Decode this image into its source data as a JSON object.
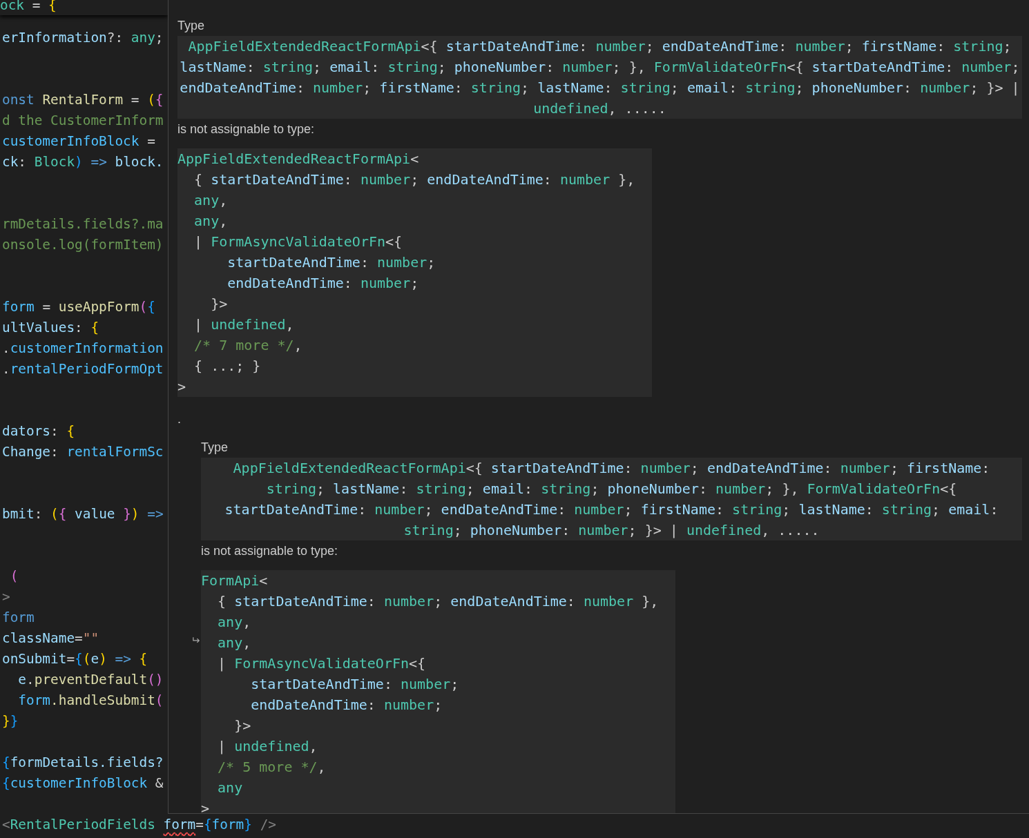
{
  "editor": {
    "sticky_line": {
      "tokens": [
        {
          "kind": "type",
          "text": "ock"
        },
        {
          "kind": "punct",
          "text": " = "
        },
        {
          "kind": "bracket1",
          "text": "{"
        }
      ]
    },
    "lines": [
      {
        "kind": "code",
        "tokens": [
          {
            "kind": "variable",
            "text": "erInformation"
          },
          {
            "kind": "punct",
            "text": "?: "
          },
          {
            "kind": "type",
            "text": "any"
          },
          {
            "kind": "punct",
            "text": ";"
          }
        ]
      },
      {
        "kind": "blank"
      },
      {
        "kind": "blank"
      },
      {
        "kind": "code",
        "tokens": [
          {
            "kind": "keyword",
            "text": "onst "
          },
          {
            "kind": "function",
            "text": "RentalForm"
          },
          {
            "kind": "punct",
            "text": " = "
          },
          {
            "kind": "bracket1",
            "text": "("
          },
          {
            "kind": "bracket2",
            "text": "{"
          }
        ]
      },
      {
        "kind": "code",
        "tokens": [
          {
            "kind": "comment",
            "text": "d the CustomerInform"
          }
        ]
      },
      {
        "kind": "code",
        "tokens": [
          {
            "kind": "constant",
            "text": "customerInfoBlock"
          },
          {
            "kind": "punct",
            "text": " ="
          }
        ]
      },
      {
        "kind": "code",
        "tokens": [
          {
            "kind": "variable",
            "text": "ck"
          },
          {
            "kind": "punct",
            "text": ": "
          },
          {
            "kind": "type",
            "text": "Block"
          },
          {
            "kind": "bracket3",
            "text": ") "
          },
          {
            "kind": "keyword",
            "text": "=> "
          },
          {
            "kind": "variable",
            "text": "block."
          }
        ]
      },
      {
        "kind": "blank"
      },
      {
        "kind": "blank"
      },
      {
        "kind": "code",
        "tokens": [
          {
            "kind": "comment",
            "text": "rmDetails.fields?.ma"
          }
        ]
      },
      {
        "kind": "code",
        "tokens": [
          {
            "kind": "comment",
            "text": "onsole.log(formItem)"
          }
        ]
      },
      {
        "kind": "blank"
      },
      {
        "kind": "blank"
      },
      {
        "kind": "code",
        "tokens": [
          {
            "kind": "constant",
            "text": "form"
          },
          {
            "kind": "punct",
            "text": " = "
          },
          {
            "kind": "function",
            "text": "useAppForm"
          },
          {
            "kind": "bracket2",
            "text": "("
          },
          {
            "kind": "bracket3",
            "text": "{"
          }
        ]
      },
      {
        "kind": "code",
        "tokens": [
          {
            "kind": "variable",
            "text": "ultValues"
          },
          {
            "kind": "punct",
            "text": ": "
          },
          {
            "kind": "bracket1",
            "text": "{"
          }
        ]
      },
      {
        "kind": "code",
        "tokens": [
          {
            "kind": "punct",
            "text": "."
          },
          {
            "kind": "constant",
            "text": "customerInformation"
          }
        ]
      },
      {
        "kind": "code",
        "tokens": [
          {
            "kind": "punct",
            "text": "."
          },
          {
            "kind": "constant",
            "text": "rentalPeriodFormOpt"
          }
        ]
      },
      {
        "kind": "blank"
      },
      {
        "kind": "blank"
      },
      {
        "kind": "code",
        "tokens": [
          {
            "kind": "variable",
            "text": "dators"
          },
          {
            "kind": "punct",
            "text": ": "
          },
          {
            "kind": "bracket1",
            "text": "{"
          }
        ]
      },
      {
        "kind": "code",
        "tokens": [
          {
            "kind": "variable",
            "text": "Change"
          },
          {
            "kind": "punct",
            "text": ": "
          },
          {
            "kind": "constant",
            "text": "rentalFormSc"
          }
        ]
      },
      {
        "kind": "blank"
      },
      {
        "kind": "blank"
      },
      {
        "kind": "code",
        "tokens": [
          {
            "kind": "variable",
            "text": "bmit"
          },
          {
            "kind": "punct",
            "text": ": "
          },
          {
            "kind": "bracket1",
            "text": "("
          },
          {
            "kind": "bracket2",
            "text": "{ "
          },
          {
            "kind": "variable",
            "text": "value "
          },
          {
            "kind": "bracket2",
            "text": "}"
          },
          {
            "kind": "bracket1",
            "text": ") "
          },
          {
            "kind": "keyword",
            "text": "=>"
          }
        ]
      },
      {
        "kind": "blank"
      },
      {
        "kind": "blank"
      },
      {
        "kind": "code",
        "tokens": [
          {
            "kind": "bracket2",
            "text": " ("
          }
        ]
      },
      {
        "kind": "code",
        "tokens": [
          {
            "kind": "tag",
            "text": ">"
          }
        ]
      },
      {
        "kind": "code",
        "tokens": [
          {
            "kind": "keyword",
            "text": "form"
          }
        ]
      },
      {
        "kind": "code",
        "tokens": [
          {
            "kind": "variable",
            "text": "className"
          },
          {
            "kind": "punct",
            "text": "="
          },
          {
            "kind": "string",
            "text": "\"\""
          }
        ]
      },
      {
        "kind": "code",
        "tokens": [
          {
            "kind": "variable",
            "text": "onSubmit"
          },
          {
            "kind": "punct",
            "text": "="
          },
          {
            "kind": "bracket3",
            "text": "{"
          },
          {
            "kind": "bracket1",
            "text": "("
          },
          {
            "kind": "variable",
            "text": "e"
          },
          {
            "kind": "bracket1",
            "text": ") "
          },
          {
            "kind": "keyword",
            "text": "=> "
          },
          {
            "kind": "bracket1",
            "text": "{"
          }
        ]
      },
      {
        "kind": "code",
        "tokens": [
          {
            "kind": "variable",
            "text": "  e"
          },
          {
            "kind": "punct",
            "text": "."
          },
          {
            "kind": "function",
            "text": "preventDefault"
          },
          {
            "kind": "bracket2",
            "text": "()"
          }
        ]
      },
      {
        "kind": "code",
        "tokens": [
          {
            "kind": "constant",
            "text": "  form"
          },
          {
            "kind": "function",
            "text": ".handleSubmit"
          },
          {
            "kind": "bracket2",
            "text": "("
          }
        ]
      },
      {
        "kind": "code",
        "tokens": [
          {
            "kind": "bracket1",
            "text": "}"
          },
          {
            "kind": "bracket3",
            "text": "}"
          }
        ]
      },
      {
        "kind": "blank"
      },
      {
        "kind": "code",
        "tokens": [
          {
            "kind": "bracket3",
            "text": "{"
          },
          {
            "kind": "variable",
            "text": "formDetails.fields?"
          }
        ]
      },
      {
        "kind": "code",
        "tokens": [
          {
            "kind": "bracket3",
            "text": "{"
          },
          {
            "kind": "constant",
            "text": "customerInfoBlock"
          },
          {
            "kind": "punct",
            "text": " &"
          }
        ]
      },
      {
        "kind": "blank"
      },
      {
        "kind": "code",
        "tokens": [
          {
            "kind": "tag",
            "text": "<"
          },
          {
            "kind": "type",
            "text": "RentalPeriodFields "
          },
          {
            "kind": "variable",
            "text": "form",
            "error": true
          },
          {
            "kind": "punct",
            "text": "="
          },
          {
            "kind": "bracket3",
            "text": "{"
          },
          {
            "kind": "constant",
            "text": "form"
          },
          {
            "kind": "bracket3",
            "text": "} "
          },
          {
            "kind": "tag",
            "text": "/>"
          }
        ]
      }
    ]
  },
  "hover": {
    "label": "Type",
    "source_type": [
      {
        "kind": "type",
        "text": "AppFieldExtendedReactFormApi"
      },
      {
        "kind": "punct",
        "text": "<{ "
      },
      {
        "kind": "prop",
        "text": "startDateAndTime"
      },
      {
        "kind": "punct",
        "text": ": "
      },
      {
        "kind": "type",
        "text": "number"
      },
      {
        "kind": "punct",
        "text": "; "
      },
      {
        "kind": "prop",
        "text": "endDateAndTime"
      },
      {
        "kind": "punct",
        "text": ": "
      },
      {
        "kind": "type",
        "text": "number"
      },
      {
        "kind": "punct",
        "text": "; "
      },
      {
        "kind": "prop",
        "text": "firstName"
      },
      {
        "kind": "punct",
        "text": ": "
      },
      {
        "kind": "type",
        "text": "string"
      },
      {
        "kind": "punct",
        "text": "; "
      },
      {
        "kind": "prop",
        "text": "lastName"
      },
      {
        "kind": "punct",
        "text": ": "
      },
      {
        "kind": "type",
        "text": "string"
      },
      {
        "kind": "punct",
        "text": "; "
      },
      {
        "kind": "prop",
        "text": "email"
      },
      {
        "kind": "punct",
        "text": ": "
      },
      {
        "kind": "type",
        "text": "string"
      },
      {
        "kind": "punct",
        "text": "; "
      },
      {
        "kind": "prop",
        "text": "phoneNumber"
      },
      {
        "kind": "punct",
        "text": ": "
      },
      {
        "kind": "type",
        "text": "number"
      },
      {
        "kind": "punct",
        "text": "; }, "
      },
      {
        "kind": "type",
        "text": "FormValidateOrFn"
      },
      {
        "kind": "punct",
        "text": "<{ "
      },
      {
        "kind": "prop",
        "text": "startDateAndTime"
      },
      {
        "kind": "punct",
        "text": ": "
      },
      {
        "kind": "type",
        "text": "number"
      },
      {
        "kind": "punct",
        "text": "; "
      },
      {
        "kind": "prop",
        "text": "endDateAndTime"
      },
      {
        "kind": "punct",
        "text": ": "
      },
      {
        "kind": "type",
        "text": "number"
      },
      {
        "kind": "punct",
        "text": "; "
      },
      {
        "kind": "prop",
        "text": "firstName"
      },
      {
        "kind": "punct",
        "text": ": "
      },
      {
        "kind": "type",
        "text": "string"
      },
      {
        "kind": "punct",
        "text": "; "
      },
      {
        "kind": "prop",
        "text": "lastName"
      },
      {
        "kind": "punct",
        "text": ": "
      },
      {
        "kind": "type",
        "text": "string"
      },
      {
        "kind": "punct",
        "text": "; "
      },
      {
        "kind": "prop",
        "text": "email"
      },
      {
        "kind": "punct",
        "text": ": "
      },
      {
        "kind": "type",
        "text": "string"
      },
      {
        "kind": "punct",
        "text": "; "
      },
      {
        "kind": "prop",
        "text": "phoneNumber"
      },
      {
        "kind": "punct",
        "text": ": "
      },
      {
        "kind": "type",
        "text": "number"
      },
      {
        "kind": "punct",
        "text": "; }> | "
      },
      {
        "kind": "type",
        "text": "undefined"
      },
      {
        "kind": "punct",
        "text": ", ....."
      }
    ],
    "relation": "is not assignable to type:",
    "target_type": [
      [
        {
          "kind": "type",
          "text": "AppFieldExtendedReactFormApi"
        },
        {
          "kind": "punct",
          "text": "<"
        }
      ],
      [
        {
          "kind": "punct",
          "text": "  { "
        },
        {
          "kind": "prop",
          "text": "startDateAndTime"
        },
        {
          "kind": "punct",
          "text": ": "
        },
        {
          "kind": "type",
          "text": "number"
        },
        {
          "kind": "punct",
          "text": "; "
        },
        {
          "kind": "prop",
          "text": "endDateAndTime"
        },
        {
          "kind": "punct",
          "text": ": "
        },
        {
          "kind": "type",
          "text": "number"
        },
        {
          "kind": "punct",
          "text": " },"
        }
      ],
      [
        {
          "kind": "type",
          "text": "  any"
        },
        {
          "kind": "punct",
          "text": ","
        }
      ],
      [
        {
          "kind": "type",
          "text": "  any"
        },
        {
          "kind": "punct",
          "text": ","
        }
      ],
      [
        {
          "kind": "punct",
          "text": "  | "
        },
        {
          "kind": "type",
          "text": "FormAsyncValidateOrFn"
        },
        {
          "kind": "punct",
          "text": "<{"
        }
      ],
      [
        {
          "kind": "prop",
          "text": "      startDateAndTime"
        },
        {
          "kind": "punct",
          "text": ": "
        },
        {
          "kind": "type",
          "text": "number"
        },
        {
          "kind": "punct",
          "text": ";"
        }
      ],
      [
        {
          "kind": "prop",
          "text": "      endDateAndTime"
        },
        {
          "kind": "punct",
          "text": ": "
        },
        {
          "kind": "type",
          "text": "number"
        },
        {
          "kind": "punct",
          "text": ";"
        }
      ],
      [
        {
          "kind": "punct",
          "text": "    }>"
        }
      ],
      [
        {
          "kind": "punct",
          "text": "  | "
        },
        {
          "kind": "type",
          "text": "undefined"
        },
        {
          "kind": "punct",
          "text": ","
        }
      ],
      [
        {
          "kind": "comment",
          "text": "  /* 7 more */"
        },
        {
          "kind": "punct",
          "text": ","
        }
      ],
      [
        {
          "kind": "punct",
          "text": "  { ...; }"
        }
      ],
      [
        {
          "kind": "punct",
          "text": ">"
        }
      ]
    ],
    "trailing_text": ".",
    "children": [
      {
        "label": "Type",
        "source_type": [
          {
            "kind": "type",
            "text": "AppFieldExtendedReactFormApi"
          },
          {
            "kind": "punct",
            "text": "<{ "
          },
          {
            "kind": "prop",
            "text": "startDateAndTime"
          },
          {
            "kind": "punct",
            "text": ": "
          },
          {
            "kind": "type",
            "text": "number"
          },
          {
            "kind": "punct",
            "text": "; "
          },
          {
            "kind": "prop",
            "text": "endDateAndTime"
          },
          {
            "kind": "punct",
            "text": ": "
          },
          {
            "kind": "type",
            "text": "number"
          },
          {
            "kind": "punct",
            "text": "; "
          },
          {
            "kind": "prop",
            "text": "firstName"
          },
          {
            "kind": "punct",
            "text": ": "
          },
          {
            "kind": "type",
            "text": "string"
          },
          {
            "kind": "punct",
            "text": "; "
          },
          {
            "kind": "prop",
            "text": "lastName"
          },
          {
            "kind": "punct",
            "text": ": "
          },
          {
            "kind": "type",
            "text": "string"
          },
          {
            "kind": "punct",
            "text": "; "
          },
          {
            "kind": "prop",
            "text": "email"
          },
          {
            "kind": "punct",
            "text": ": "
          },
          {
            "kind": "type",
            "text": "string"
          },
          {
            "kind": "punct",
            "text": "; "
          },
          {
            "kind": "prop",
            "text": "phoneNumber"
          },
          {
            "kind": "punct",
            "text": ": "
          },
          {
            "kind": "type",
            "text": "number"
          },
          {
            "kind": "punct",
            "text": "; }, "
          },
          {
            "kind": "type",
            "text": "FormValidateOrFn"
          },
          {
            "kind": "punct",
            "text": "<{ "
          },
          {
            "kind": "prop",
            "text": "startDateAndTime"
          },
          {
            "kind": "punct",
            "text": ": "
          },
          {
            "kind": "type",
            "text": "number"
          },
          {
            "kind": "punct",
            "text": "; "
          },
          {
            "kind": "prop",
            "text": "endDateAndTime"
          },
          {
            "kind": "punct",
            "text": ": "
          },
          {
            "kind": "type",
            "text": "number"
          },
          {
            "kind": "punct",
            "text": "; "
          },
          {
            "kind": "prop",
            "text": "firstName"
          },
          {
            "kind": "punct",
            "text": ": "
          },
          {
            "kind": "type",
            "text": "string"
          },
          {
            "kind": "punct",
            "text": "; "
          },
          {
            "kind": "prop",
            "text": "lastName"
          },
          {
            "kind": "punct",
            "text": ": "
          },
          {
            "kind": "type",
            "text": "string"
          },
          {
            "kind": "punct",
            "text": "; "
          },
          {
            "kind": "prop",
            "text": "email"
          },
          {
            "kind": "punct",
            "text": ": "
          },
          {
            "kind": "type",
            "text": "string"
          },
          {
            "kind": "punct",
            "text": "; "
          },
          {
            "kind": "prop",
            "text": "phoneNumber"
          },
          {
            "kind": "punct",
            "text": ": "
          },
          {
            "kind": "type",
            "text": "number"
          },
          {
            "kind": "punct",
            "text": "; }> | "
          },
          {
            "kind": "type",
            "text": "undefined"
          },
          {
            "kind": "punct",
            "text": ", ....."
          }
        ],
        "relation": "is not assignable to type:",
        "target_type": [
          [
            {
              "kind": "type",
              "text": "FormApi"
            },
            {
              "kind": "punct",
              "text": "<"
            }
          ],
          [
            {
              "kind": "punct",
              "text": "  { "
            },
            {
              "kind": "prop",
              "text": "startDateAndTime"
            },
            {
              "kind": "punct",
              "text": ": "
            },
            {
              "kind": "type",
              "text": "number"
            },
            {
              "kind": "punct",
              "text": "; "
            },
            {
              "kind": "prop",
              "text": "endDateAndTime"
            },
            {
              "kind": "punct",
              "text": ": "
            },
            {
              "kind": "type",
              "text": "number"
            },
            {
              "kind": "punct",
              "text": " },"
            }
          ],
          [
            {
              "kind": "type",
              "text": "  any"
            },
            {
              "kind": "punct",
              "text": ","
            }
          ],
          [
            {
              "kind": "type",
              "text": "  any"
            },
            {
              "kind": "punct",
              "text": ","
            }
          ],
          [
            {
              "kind": "punct",
              "text": "  | "
            },
            {
              "kind": "type",
              "text": "FormAsyncValidateOrFn"
            },
            {
              "kind": "punct",
              "text": "<{"
            }
          ],
          [
            {
              "kind": "prop",
              "text": "      startDateAndTime"
            },
            {
              "kind": "punct",
              "text": ": "
            },
            {
              "kind": "type",
              "text": "number"
            },
            {
              "kind": "punct",
              "text": ";"
            }
          ],
          [
            {
              "kind": "prop",
              "text": "      endDateAndTime"
            },
            {
              "kind": "punct",
              "text": ": "
            },
            {
              "kind": "type",
              "text": "number"
            },
            {
              "kind": "punct",
              "text": ";"
            }
          ],
          [
            {
              "kind": "punct",
              "text": "    }>"
            }
          ],
          [
            {
              "kind": "punct",
              "text": "  | "
            },
            {
              "kind": "type",
              "text": "undefined"
            },
            {
              "kind": "punct",
              "text": ","
            }
          ],
          [
            {
              "kind": "comment",
              "text": "  /* 5 more */"
            },
            {
              "kind": "punct",
              "text": ","
            }
          ],
          [
            {
              "kind": "type",
              "text": "  any"
            }
          ],
          [
            {
              "kind": "punct",
              "text": ">"
            }
          ]
        ]
      }
    ]
  }
}
